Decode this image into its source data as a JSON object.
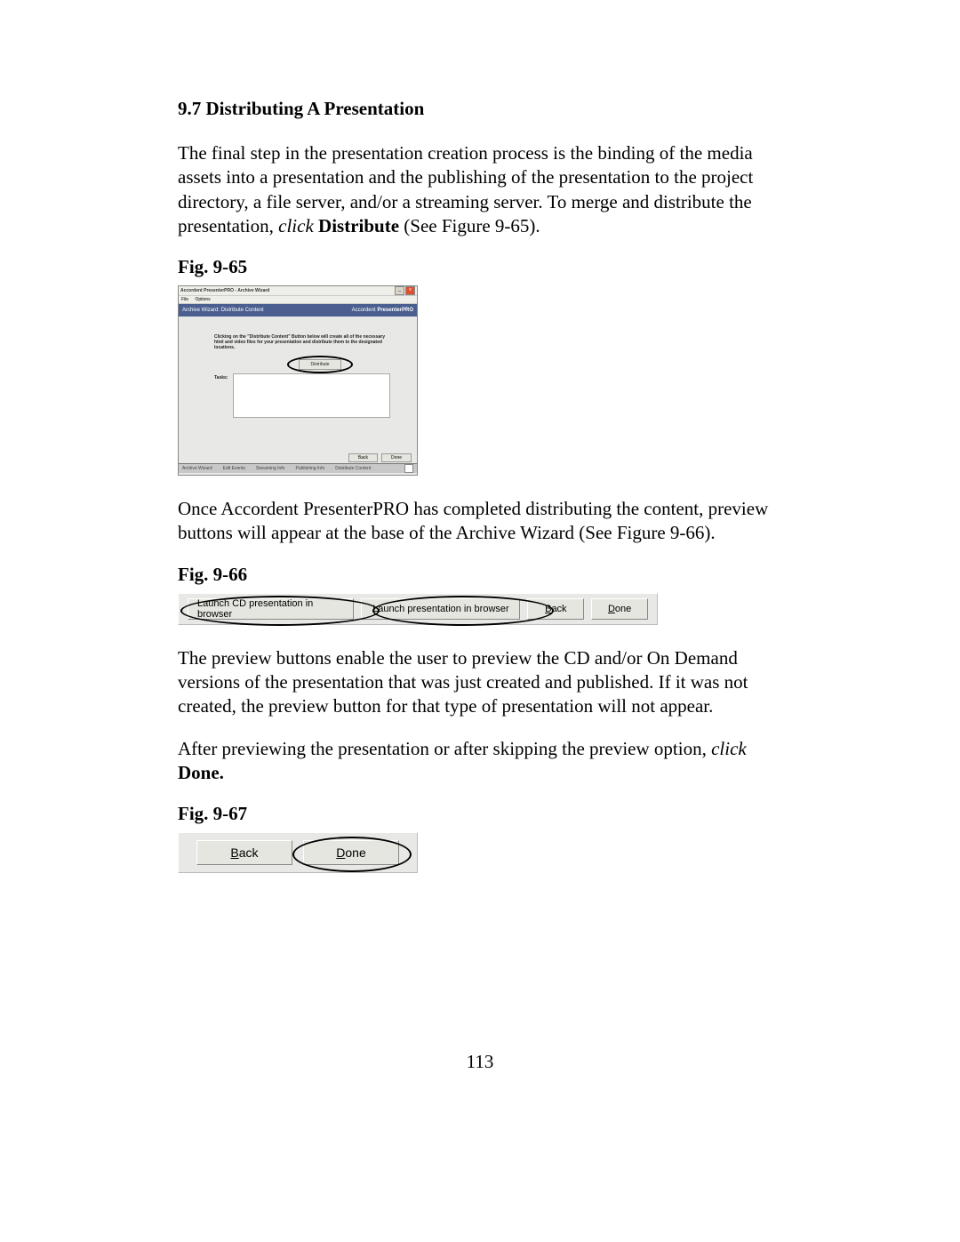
{
  "headings": {
    "section": "9.7  Distributing A Presentation"
  },
  "paragraphs": {
    "p1_a": "The final step in the presentation creation process is the binding of the media assets into a presentation and the publishing of the presentation to the project directory, a file server, and/or a streaming server.  To merge and distribute the presentation, ",
    "p1_click": "click",
    "p1_distribute": " Distribute",
    "p1_b": " (See Figure 9-65).",
    "p2": "Once Accordent PresenterPRO has completed distributing the content, preview buttons will appear at the base of the Archive Wizard (See Figure 9-66).",
    "p3": "The preview buttons enable the user to preview the CD and/or On Demand versions of the presentation that was just created and published.  If it was not created, the preview button for that type of presentation will not appear.",
    "p4_a": "After previewing the presentation or after skipping the preview option, ",
    "p4_click": "click",
    "p4_done": "Done."
  },
  "captions": {
    "fig65": "Fig.  9-65",
    "fig66": "Fig. 9-66",
    "fig67": "Fig. 9-67"
  },
  "page_number": "113",
  "fig65": {
    "window_title": "Accordent PresenterPRO - Archive Wizard",
    "menu_file": "File",
    "menu_options": "Options",
    "bluebar_left": "Archive Wizard: Distribute Content",
    "brand_a": "Accordent ",
    "brand_b": "PresenterPRO",
    "instructions": "Clicking on the \"Distribute Content\" Button below will create all of the necessary html and video files for your presentation and distribute them to the designated locations.",
    "distribute_btn": "Distribute",
    "tasks_label": "Tasks:",
    "back_btn": "Back",
    "done_btn": "Done",
    "tab1": "Archive Wizard",
    "tab2": "Edit Events",
    "tab3": "Streaming Info",
    "tab4": "Publishing Info",
    "tab5": "Distribute Content"
  },
  "fig66": {
    "btn_launch_cd": "Launch CD presentation in browser",
    "btn_launch": "Launch presentation in browser",
    "back_u": "B",
    "back_rest": "ack",
    "done_u": "D",
    "done_rest": "one"
  },
  "fig67": {
    "back_u": "B",
    "back_rest": "ack",
    "done_u": "D",
    "done_rest": "one"
  }
}
